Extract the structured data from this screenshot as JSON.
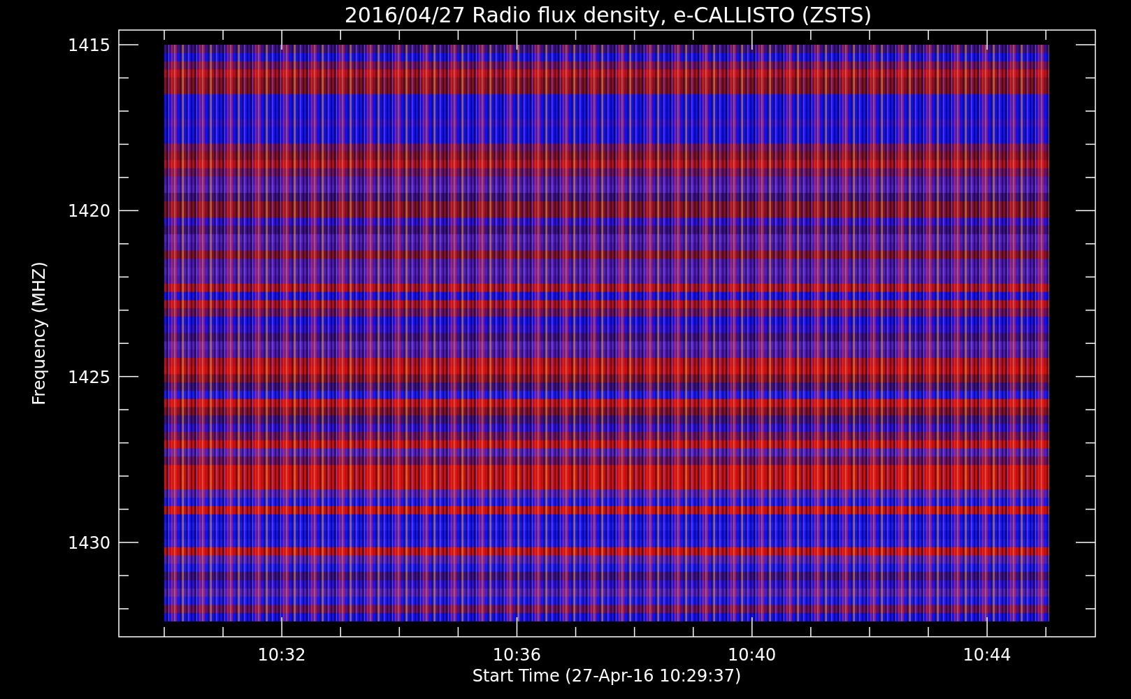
{
  "title": "2016/04/27  Radio flux density, e-CALLISTO (ZSTS)",
  "ylabel": "Frequency (MHZ)",
  "xlabel": "Start Time (27-Apr-16 10:29:37)",
  "yticks": [
    "1415",
    "1420",
    "1425",
    "1430"
  ],
  "xticks": [
    "10:32",
    "10:36",
    "10:40",
    "10:44"
  ]
}
